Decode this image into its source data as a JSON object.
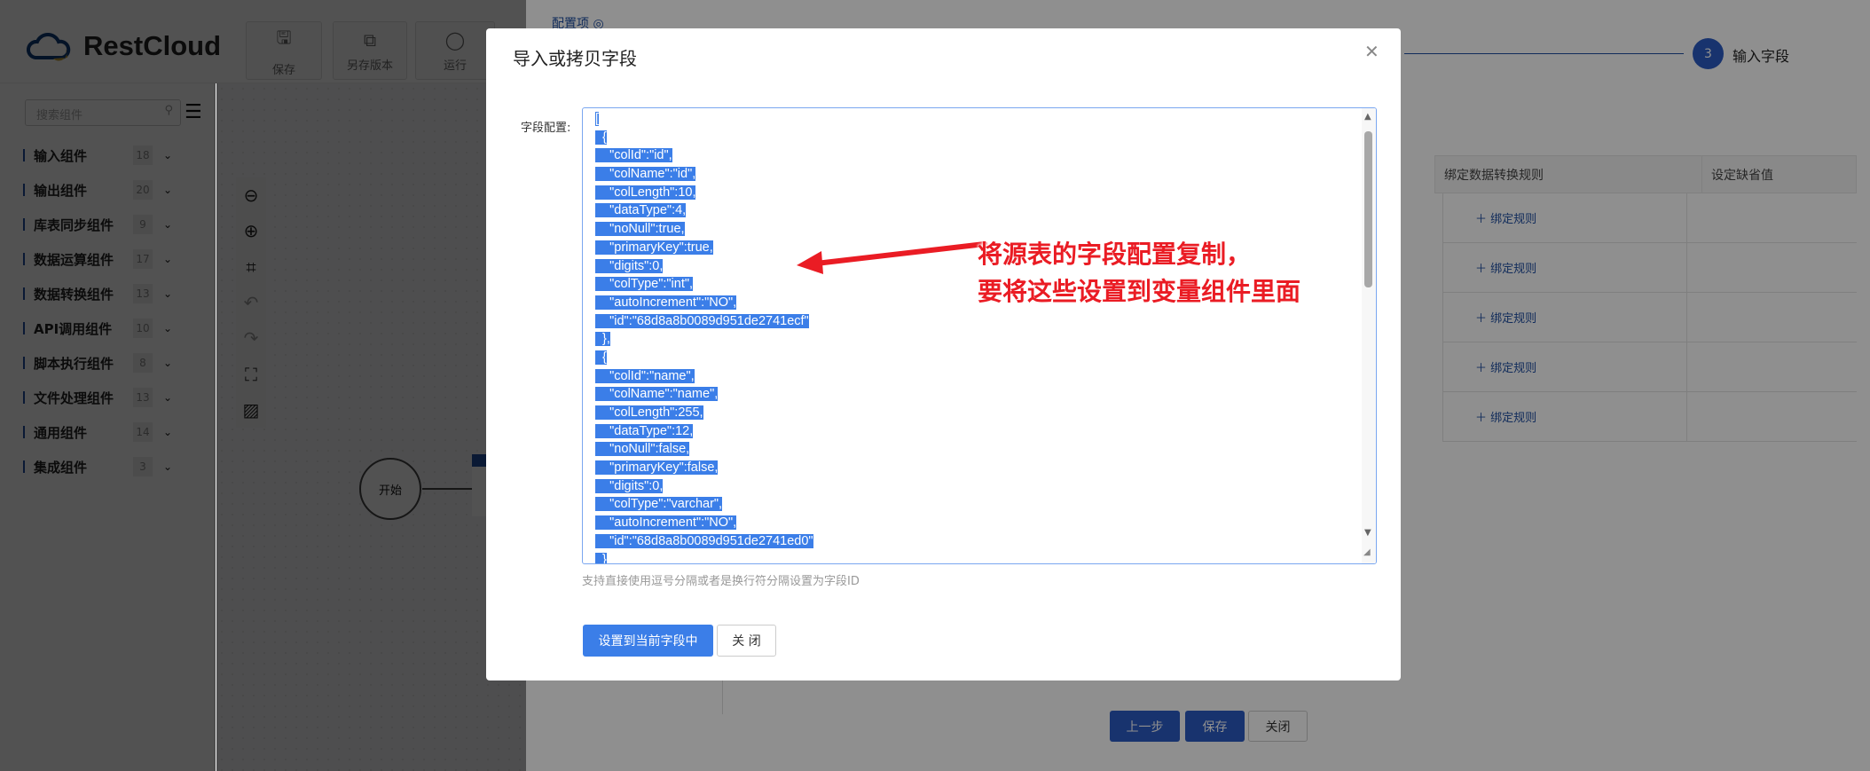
{
  "app": {
    "brand": "RestCloud"
  },
  "toolbar": {
    "save": "保存",
    "save_version": "另存版本",
    "run": "运行"
  },
  "sidebar": {
    "search_placeholder": "搜索组件",
    "categories": [
      {
        "label": "输入组件",
        "count": "18"
      },
      {
        "label": "输出组件",
        "count": "20"
      },
      {
        "label": "库表同步组件",
        "count": "9"
      },
      {
        "label": "数据运算组件",
        "count": "17"
      },
      {
        "label": "数据转换组件",
        "count": "13"
      },
      {
        "label": "API调用组件",
        "count": "10"
      },
      {
        "label": "脚本执行组件",
        "count": "8"
      },
      {
        "label": "文件处理组件",
        "count": "13"
      },
      {
        "label": "通用组件",
        "count": "14"
      },
      {
        "label": "集成组件",
        "count": "3"
      }
    ]
  },
  "canvas": {
    "start_node": "开始"
  },
  "drawer": {
    "config_tab": "配置项",
    "step": {
      "number": "3",
      "label": "输入字段"
    },
    "table": {
      "headers": [
        "绑定数据转换规则",
        "设定缺省值"
      ],
      "rows": [
        "绑定规则",
        "绑定规则",
        "绑定规则",
        "绑定规则",
        "绑定规则"
      ]
    },
    "buttons": {
      "prev": "上一步",
      "save": "保存",
      "close": "关闭"
    }
  },
  "modal": {
    "title": "导入或拷贝字段",
    "field_label": "字段配置:",
    "code_lines": [
      "[",
      "  {",
      "    \"colId\":\"id\",",
      "    \"colName\":\"id\",",
      "    \"colLength\":10,",
      "    \"dataType\":4,",
      "    \"noNull\":true,",
      "    \"primaryKey\":true,",
      "    \"digits\":0,",
      "    \"colType\":\"int\",",
      "    \"autoIncrement\":\"NO\",",
      "    \"id\":\"68d8a8b0089d951de2741ecf\"",
      "  },",
      "  {",
      "    \"colId\":\"name\",",
      "    \"colName\":\"name\",",
      "    \"colLength\":255,",
      "    \"dataType\":12,",
      "    \"noNull\":false,",
      "    \"primaryKey\":false,",
      "    \"digits\":0,",
      "    \"colType\":\"varchar\",",
      "    \"autoIncrement\":\"NO\",",
      "    \"id\":\"68d8a8b0089d951de2741ed0\"",
      "  }"
    ],
    "hint": "支持直接使用逗号分隔或者是换行符分隔设置为字段ID",
    "apply_button": "设置到当前字段中",
    "close_button": "关 闭"
  },
  "annotation": {
    "line1": "将源表的字段配置复制，",
    "line2": "要将这些设置到变量组件里面",
    "color": "#ea1c24"
  }
}
